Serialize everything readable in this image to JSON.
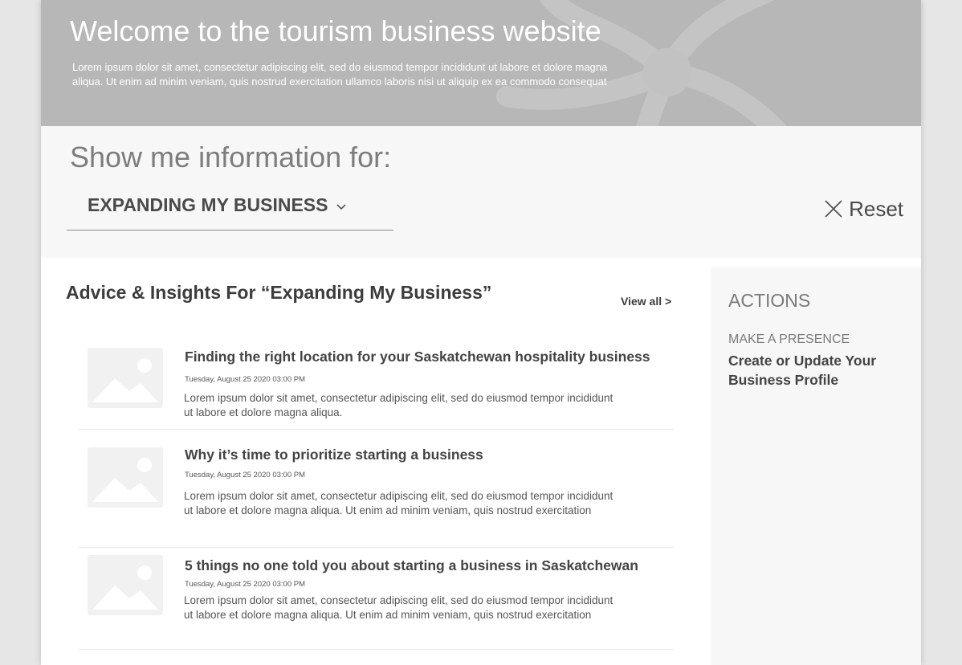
{
  "hero": {
    "title": "Welcome to the tourism business website",
    "description": "Lorem ipsum dolor sit amet, consectetur adipiscing elit, sed do eiusmod tempor incididunt ut labore et dolore magna aliqua. Ut enim ad minim veniam, quis nostrud exercitation ullamco laboris nisi ut aliquip ex ea commodo consequat"
  },
  "filter": {
    "heading": "Show me information for:",
    "selected": "EXPANDING MY BUSINESS",
    "reset_label": "Reset"
  },
  "main": {
    "section_title": "Advice & Insights For “Expanding My Business”",
    "view_all": "View all >",
    "articles": [
      {
        "title": "Finding the right location for your Saskatchewan hospitality business",
        "date": "Tuesday, August 25 2020 03:00 PM",
        "excerpt": "Lorem ipsum dolor sit amet, consectetur adipiscing elit, sed do eiusmod tempor incididunt ut labore et dolore magna aliqua."
      },
      {
        "title": "Why it’s time to prioritize starting a business",
        "date": "Tuesday, August 25 2020 03:00 PM",
        "excerpt": "Lorem ipsum dolor sit amet, consectetur adipiscing elit, sed do eiusmod tempor incididunt ut labore et dolore magna aliqua. Ut enim ad minim veniam, quis nostrud exercitation"
      },
      {
        "title": "5 things no one told you about starting a business in Saskatchewan",
        "date": "Tuesday, August 25 2020 03:00 PM",
        "excerpt": "Lorem ipsum dolor sit amet, consectetur adipiscing elit, sed do eiusmod tempor incididunt ut labore et dolore magna aliqua. Ut enim ad minim veniam, quis nostrud exercitation"
      }
    ]
  },
  "sidebar": {
    "heading": "ACTIONS",
    "subheading": "MAKE A PRESENCE",
    "link": "Create or Update Your Business Profile"
  },
  "icons": {
    "dropdown": "chevron-down-icon",
    "reset": "close-icon",
    "thumbnail": "image-placeholder-icon",
    "hero_decoration": "flower-logo-decoration"
  },
  "colors": {
    "hero_bg": "#b7b7b7",
    "filter_bg": "#f7f7f7",
    "sidebar_bg": "#f7f7f7",
    "text": "#4a4a4a"
  }
}
